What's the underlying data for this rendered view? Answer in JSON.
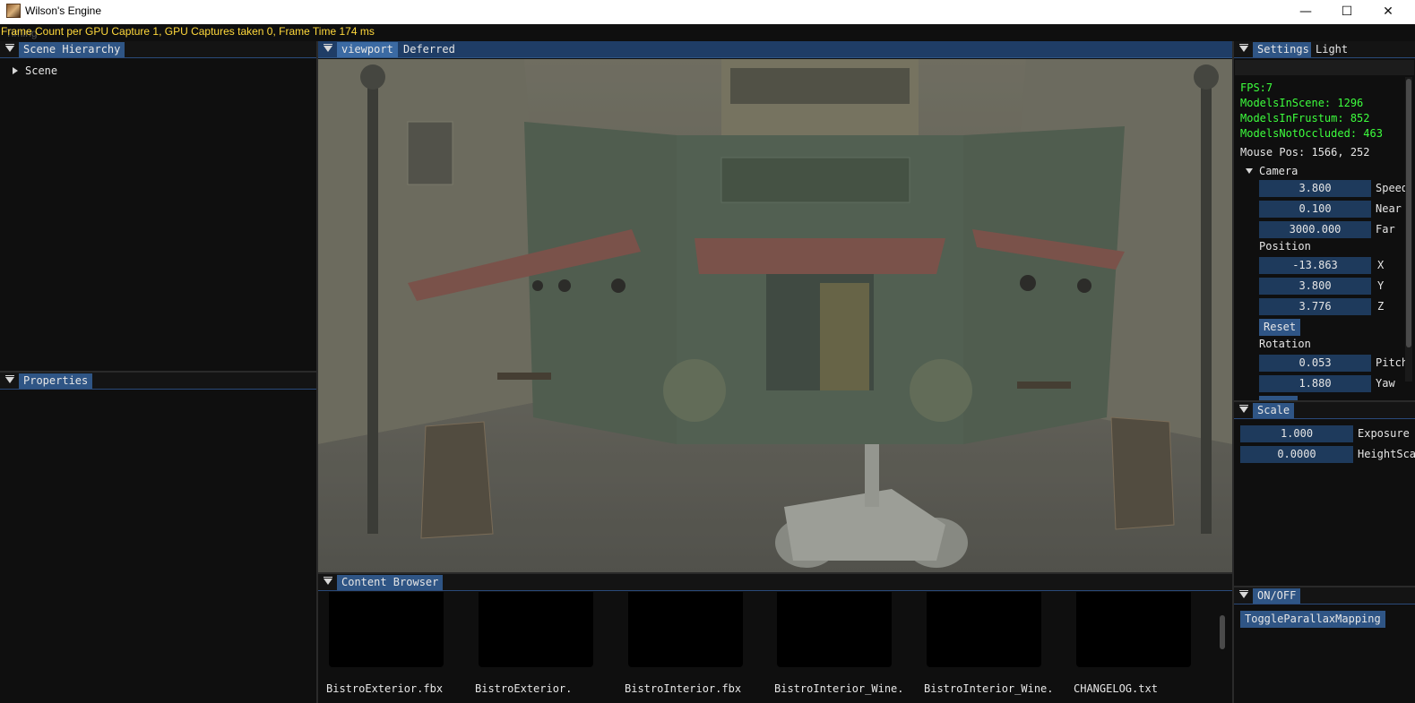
{
  "window": {
    "title": "Wilson's Engine",
    "minimize_glyph": "—",
    "maximize_glyph": "☐",
    "close_glyph": "✕"
  },
  "gpu_info": {
    "text": "Frame Count per GPU Capture 1, GPU Captures taken 0, Frame Time 174 ms",
    "ghost_text": "Timing"
  },
  "scene_hierarchy": {
    "tab": "Scene Hierarchy",
    "items": [
      "Scene"
    ]
  },
  "properties": {
    "tab": "Properties"
  },
  "viewport": {
    "tabs": [
      "viewport",
      "Deferred"
    ]
  },
  "settings": {
    "tabs": [
      "Settings",
      "Light"
    ],
    "stats": {
      "fps": "FPS:7",
      "models_in_scene": "ModelsInScene: 1296",
      "models_in_frustum": "ModelsInFrustum: 852",
      "models_not_occluded": "ModelsNotOccluded: 463"
    },
    "mouse_pos": "Mouse Pos: 1566, 252",
    "camera": {
      "header": "Camera",
      "speed": {
        "value": "3.800",
        "label": "Speed"
      },
      "near": {
        "value": "0.100",
        "label": "Near"
      },
      "far": {
        "value": "3000.000",
        "label": "Far"
      },
      "position_label": "Position",
      "x": {
        "value": "-13.863",
        "label": "X"
      },
      "y": {
        "value": "3.800",
        "label": "Y"
      },
      "z": {
        "value": "3.776",
        "label": "Z"
      },
      "reset": "Reset",
      "rotation_label": "Rotation",
      "pitch": {
        "value": "0.053",
        "label": "Pitch"
      },
      "yaw": {
        "value": "1.880",
        "label": "Yaw"
      }
    }
  },
  "scale": {
    "tab": "Scale",
    "exposure": {
      "value": "1.000",
      "label": "Exposure"
    },
    "height_scale": {
      "value": "0.0000",
      "label": "HeightScale"
    }
  },
  "onoff": {
    "tab": "ON/OFF",
    "toggle_parallax": "ToggleParallaxMapping"
  },
  "content_browser": {
    "tab": "Content Browser",
    "files": [
      "BistroExterior.fbx",
      "BistroExterior.",
      "BistroInterior.fbx",
      "BistroInterior_Wine.",
      "BistroInterior_Wine.",
      "CHANGELOG.txt"
    ]
  },
  "colors": {
    "accent": "#2f5585",
    "stats_green": "#3dff3d",
    "info_yellow": "#ffd83b",
    "field_bg": "#1e3a5c"
  },
  "icons": [
    "app-icon",
    "collapse-arrow-icon",
    "tree-expand-icon",
    "minimize-icon",
    "maximize-icon",
    "close-icon"
  ]
}
